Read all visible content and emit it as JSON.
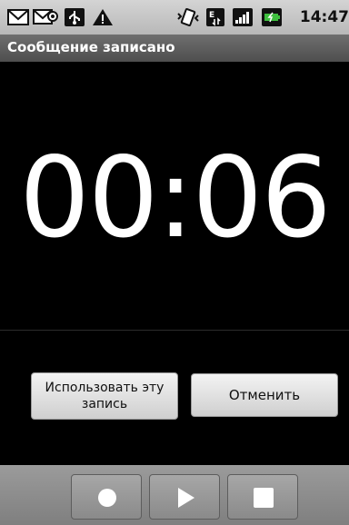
{
  "status_bar": {
    "time": "14:47",
    "icons": [
      "gmail-icon",
      "email-icon",
      "usb-icon",
      "warning-icon",
      "vibrate-icon",
      "network-e-icon",
      "signal-icon",
      "battery-charging-icon"
    ]
  },
  "title_bar": {
    "title": "Сообщение записано"
  },
  "timer": {
    "value": "00:06"
  },
  "buttons": {
    "use_label": "Использовать эту запись",
    "cancel_label": "Отменить"
  },
  "controls": {
    "record_icon": "record-icon",
    "play_icon": "play-icon",
    "stop_icon": "stop-icon"
  },
  "colors": {
    "background": "#000000",
    "status_bar": "#c8c8c8",
    "title_bar": "#5a5a5a",
    "controls_bar": "#8a8a8a"
  }
}
